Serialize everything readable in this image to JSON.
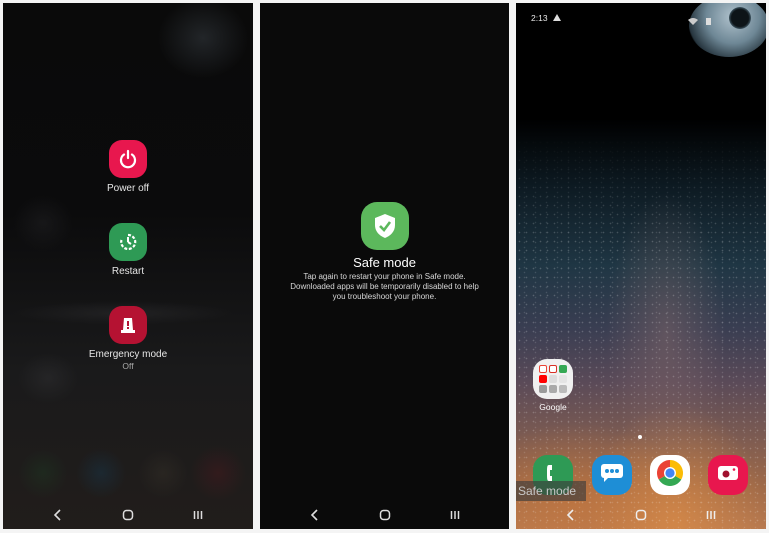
{
  "power_menu": {
    "items": [
      {
        "label": "Power off",
        "icon": "power-icon",
        "color": "#e8174e"
      },
      {
        "label": "Restart",
        "icon": "restart-icon",
        "color": "#2e9a55"
      },
      {
        "label": "Emergency mode",
        "sub": "Off",
        "icon": "emergency-siren-icon",
        "color": "#b51232"
      }
    ]
  },
  "safe_mode_prompt": {
    "title": "Safe mode",
    "icon": "shield-check-icon",
    "color": "#5cb85c",
    "description_lines": [
      "Tap again to restart your phone in Safe mode.",
      "Downloaded apps will be temporarily disabled to help",
      "you troubleshoot your phone."
    ]
  },
  "home_screen": {
    "status_bar": {
      "time": "2:13",
      "icons": [
        "warning-icon",
        "wifi-icon",
        "battery-icon"
      ]
    },
    "folder": {
      "label": "Google",
      "icons": [
        "google",
        "gmail",
        "maps",
        "youtube",
        "drive",
        "play-store",
        "play-movies",
        "duo",
        "voice"
      ]
    },
    "dock": [
      {
        "name": "phone",
        "icon": "phone-icon",
        "color": "#2e9a55"
      },
      {
        "name": "messages",
        "icon": "message-icon",
        "color": "#1e8ed6"
      },
      {
        "name": "chrome",
        "icon": "chrome-icon",
        "color": "#ffffff"
      },
      {
        "name": "camera",
        "icon": "camera-icon",
        "color": "#e8174e"
      }
    ],
    "safe_mode_badge": "Safe mode"
  },
  "nav": {
    "back": "back-icon",
    "home": "home-icon",
    "recents": "recents-icon"
  }
}
